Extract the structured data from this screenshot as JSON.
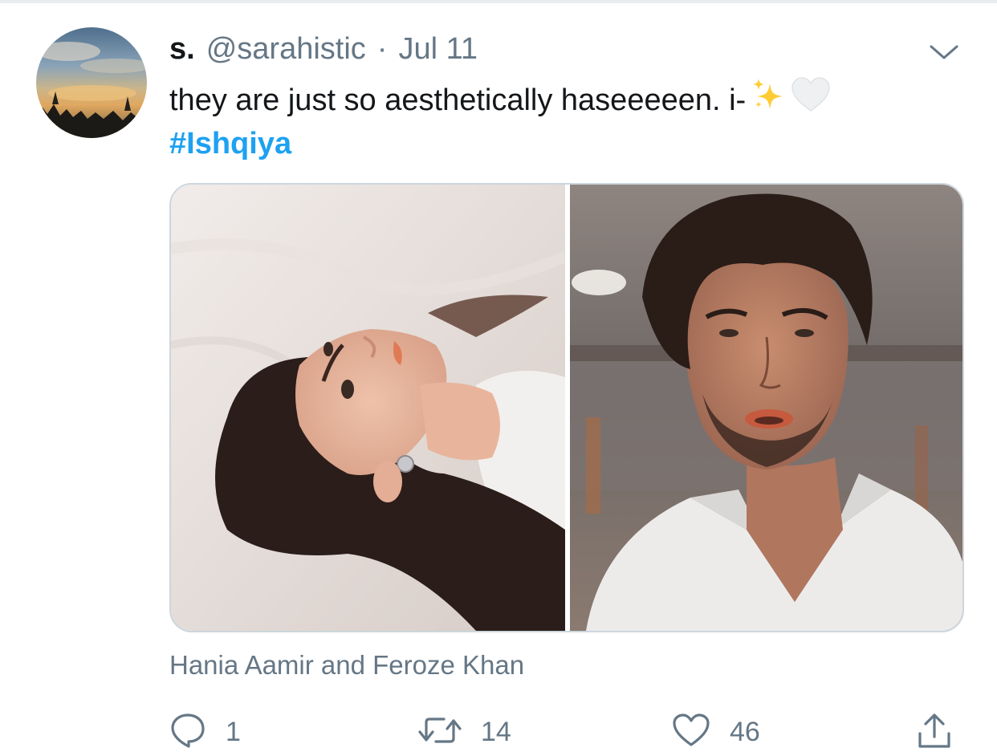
{
  "tweet": {
    "display_name": "s.",
    "handle": "@sarahistic",
    "separator": "·",
    "timestamp": "Jul 11",
    "text": "they are just so aesthetically haseeeeen. i-",
    "emoji": [
      "sparkles-icon",
      "white-heart-icon"
    ],
    "hashtag": "#Ishqiya",
    "media_caption": "Hania Aamir and Feroze Khan",
    "reply_count": "1",
    "retweet_count": "14",
    "like_count": "46"
  },
  "icons": {
    "menu": "chevron-down-icon",
    "reply": "reply-icon",
    "retweet": "retweet-icon",
    "like": "heart-icon",
    "share": "share-icon"
  },
  "colors": {
    "text_primary": "#14171a",
    "text_secondary": "#657786",
    "link": "#1da1f2",
    "border": "#ccd6dd",
    "divider": "#e6ecf0"
  }
}
